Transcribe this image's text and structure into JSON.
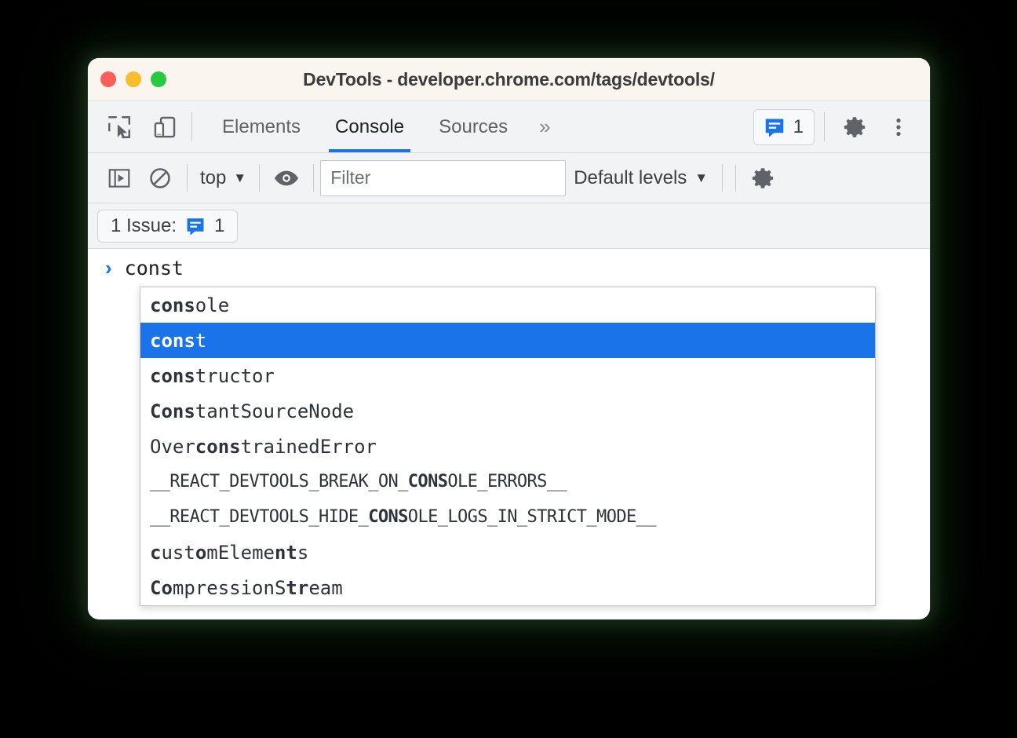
{
  "window": {
    "title": "DevTools - developer.chrome.com/tags/devtools/",
    "traffic_lights": [
      "close",
      "minimize",
      "maximize"
    ],
    "colors": {
      "close": "#FB5F57",
      "minimize": "#FBBD2E",
      "maximize": "#28C840",
      "accent": "#1A73E8",
      "titlebar_bg": "#FAF5EE",
      "toolbar_bg": "#F1F3F4"
    }
  },
  "tabbar": {
    "inspect_icon": "inspect-element-icon",
    "device_icon": "device-toolbar-icon",
    "tabs": [
      {
        "label": "Elements",
        "active": false
      },
      {
        "label": "Console",
        "active": true
      },
      {
        "label": "Sources",
        "active": false
      }
    ],
    "more_tabs_label": "»",
    "issues_count": "1",
    "issues_icon": "issues-speech-bubble-icon",
    "settings_icon": "gear-icon",
    "overflow_icon": "three-dots-vertical-icon"
  },
  "console_toolbar": {
    "sidebar_toggle_icon": "console-sidebar-toggle-icon",
    "clear_icon": "clear-console-icon",
    "context_label": "top",
    "context_caret": "▼",
    "eye_icon": "live-expression-eye-icon",
    "filter_placeholder": "Filter",
    "filter_value": "",
    "levels_label": "Default levels",
    "levels_caret": "▼",
    "settings_icon": "console-settings-gear-icon"
  },
  "issues_bar": {
    "label": "1 Issue:",
    "icon": "issues-speech-bubble-icon",
    "count": "1"
  },
  "console": {
    "prompt_caret": "›",
    "prompt_text": "const"
  },
  "autocomplete": {
    "items": [
      {
        "pre": "",
        "bold": "cons",
        "post": "ole",
        "selected": false,
        "small": false
      },
      {
        "pre": "",
        "bold": "cons",
        "post": "t",
        "selected": true,
        "small": false
      },
      {
        "pre": "",
        "bold": "cons",
        "post": "tructor",
        "selected": false,
        "small": false
      },
      {
        "pre": "",
        "bold": "Cons",
        "post": "tantSourceNode",
        "selected": false,
        "small": false
      },
      {
        "pre": "Over",
        "bold": "cons",
        "post": "trainedError",
        "selected": false,
        "small": false
      },
      {
        "pre": "__REACT_DEVTOOLS_BREAK_ON_",
        "bold": "CONS",
        "post": "OLE_ERRORS__",
        "selected": false,
        "small": true
      },
      {
        "pre": "__REACT_DEVTOOLS_HIDE_",
        "bold": "CONS",
        "post": "OLE_LOGS_IN_STRICT_MODE__",
        "selected": false,
        "small": true
      },
      {
        "pre": "",
        "bold": "c",
        "post": "ustomElements",
        "selected": false,
        "small": false,
        "fuzzy": "customElements"
      },
      {
        "pre": "",
        "bold": "Co",
        "post": "mpressionStream",
        "selected": false,
        "small": false,
        "fuzzy": "CompressionStream"
      }
    ]
  }
}
